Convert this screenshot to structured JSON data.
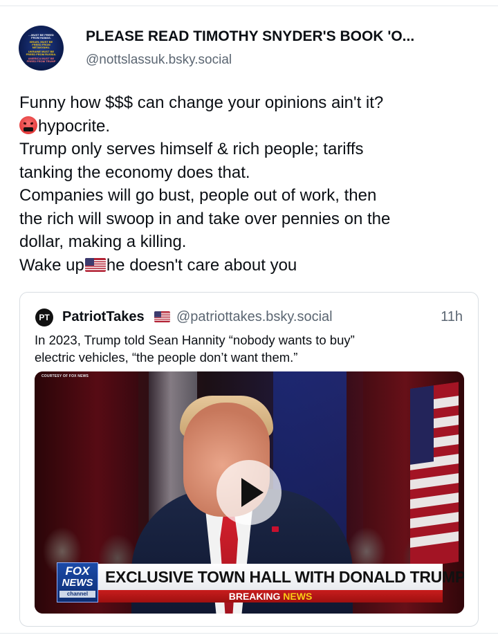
{
  "author": {
    "display_name": "PLEASE READ TIMOTHY SNYDER'S BOOK 'O...",
    "handle": "@nottslassuk.bsky.social",
    "avatar_lines": [
      "…MUST BE FREED FROM HAMAS.",
      "ISRAEL MUST BE FREED FROM NETANYAHU.",
      "UKRAINE MUST BE FREED FROM RUSSIA.",
      "AMERICA MUST BE FREED FROM TRUMP"
    ]
  },
  "post": {
    "line1": "Funny how $$$ can change your opinions ain't it?",
    "line2": "hypocrite.",
    "line3": "Trump only serves himself & rich people; tariffs",
    "line4": "tanking the economy does that.",
    "line5": "Companies will go bust, people out of work, then",
    "line6": "the rich will swoop in and take over pennies on the",
    "line7": "dollar, making a killing.",
    "line8a": "Wake up",
    "line8b": "he doesn't care about you",
    "emoji_1": "angry-face-with-symbols",
    "emoji_2": "us-flag"
  },
  "quote": {
    "avatar_text": "PT",
    "name": "PatriotTakes",
    "flag": "us-flag",
    "handle": "@patriottakes.bsky.social",
    "time": "11h",
    "text_line1": "In 2023, Trump told Sean Hannity “nobody wants to buy”",
    "text_line2": "electric vehicles, “the people don’t want them.”",
    "video": {
      "courtesy": "COURTESY OF FOX NEWS",
      "logo_fox": "FOX",
      "logo_news": "NEWS",
      "logo_channel": "channel",
      "headline": "EXCLUSIVE TOWN HALL WITH DONALD TRUMP",
      "ticker_white": "BREAKING",
      "ticker_yellow": "NEWS"
    }
  },
  "colors": {
    "text_primary": "#0b0f14",
    "text_secondary": "#5b6672",
    "border": "#d8dde2",
    "fox_red": "#c81d1d",
    "fox_blue": "#1b4aa8",
    "breaking_yellow": "#facc15"
  }
}
